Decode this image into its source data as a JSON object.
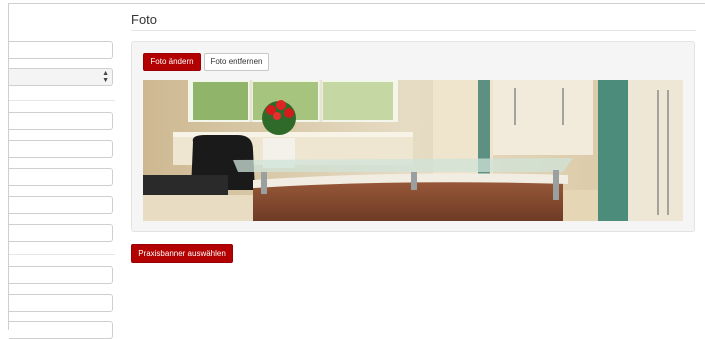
{
  "section": {
    "title": "Foto"
  },
  "photo_actions": {
    "change_label": "Foto ändern",
    "remove_label": "Foto entfernen"
  },
  "banner": {
    "select_label": "Praxisbanner auswählen"
  },
  "colors": {
    "accent": "#b30000",
    "panel_bg": "#f5f5f5"
  }
}
